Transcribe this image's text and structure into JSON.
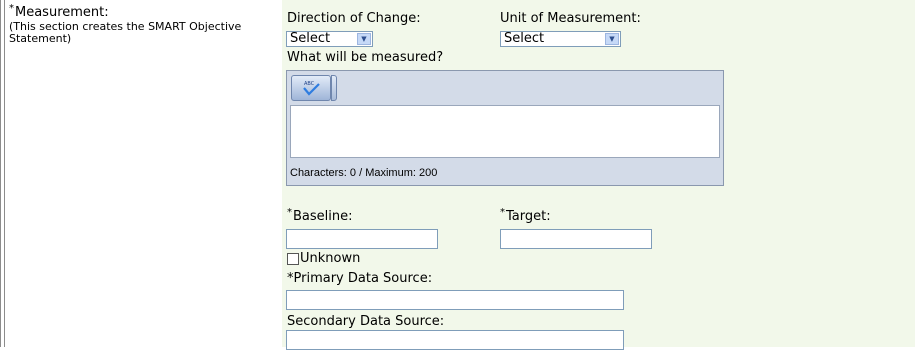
{
  "measurement": {
    "label": "Measurement:",
    "required_mark": "*",
    "note_line1": "(This section creates the SMART Objective",
    "note_line2": "Statement)"
  },
  "direction": {
    "label": "Direction of Change:",
    "selected": "Select"
  },
  "unit": {
    "label": "Unit of Measurement:",
    "selected": "Select"
  },
  "what_measured": {
    "label": "What will be measured?",
    "char_count_text": "Characters: 0 / Maximum: 200",
    "spellcheck_icon": "spellcheck-icon"
  },
  "baseline": {
    "label": "Baseline:",
    "required_mark": "*",
    "value": ""
  },
  "target": {
    "label": "Target:",
    "required_mark": "*",
    "value": ""
  },
  "unknown": {
    "label": "Unknown",
    "checked": false
  },
  "primary_source": {
    "label": "*Primary Data Source:",
    "value": ""
  },
  "secondary_source": {
    "label": "Secondary Data Source:",
    "value": ""
  },
  "colors": {
    "panel_bg": "#f2f8ea",
    "border": "#7f9db9",
    "editor_bg": "#d3dbe8"
  }
}
